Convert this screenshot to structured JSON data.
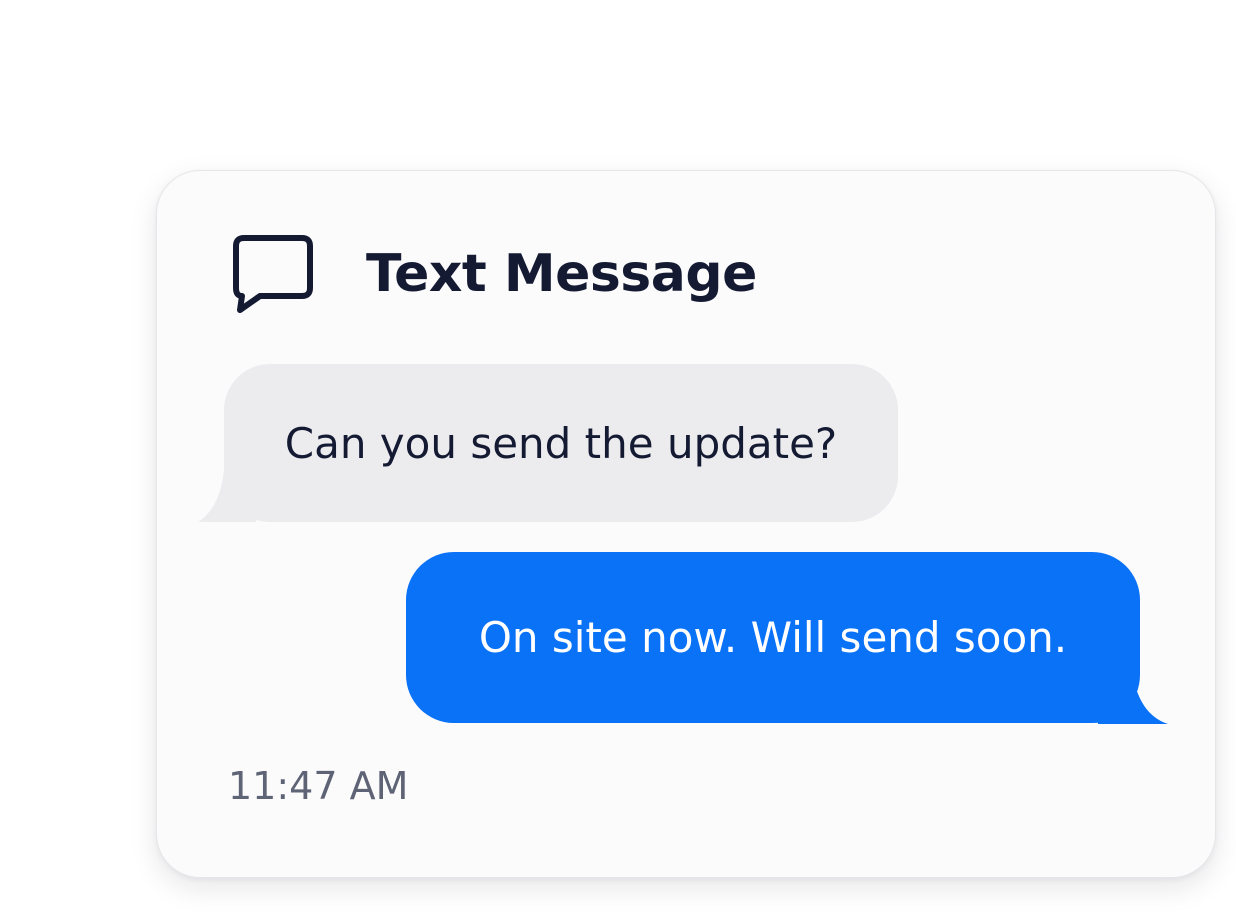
{
  "header": {
    "title": "Text Message",
    "icon": "chat-bubble-icon"
  },
  "messages": [
    {
      "direction": "incoming",
      "text": "Can you send the update?",
      "color": "#ececef"
    },
    {
      "direction": "outgoing",
      "text": "On site now. Will send soon.",
      "color": "#0a72f7"
    }
  ],
  "timestamp": "11:47 AM"
}
